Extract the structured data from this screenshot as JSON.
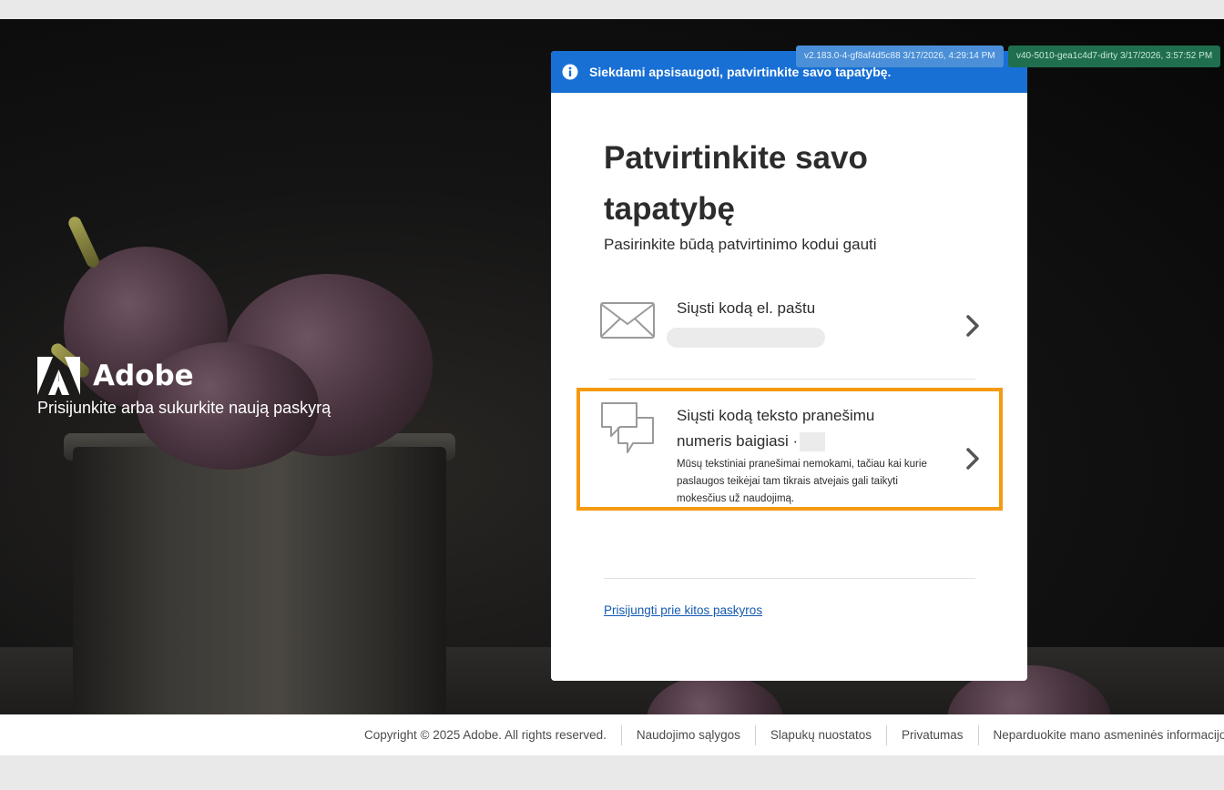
{
  "brand": {
    "name": "Adobe",
    "subtitle": "Prisijunkite arba sukurkite naują paskyrą"
  },
  "version_badges": [
    "v2.183.0-4-gf8af4d5c88 3/17/2026, 4:29:14 PM",
    "v40-5010-gea1c4d7-dirty 3/17/2026, 3:57:52 PM"
  ],
  "banner": {
    "text": "Siekdami apsisaugoti, patvirtinkite savo tapatybę.",
    "icon": "info-icon",
    "color": "#1870d5"
  },
  "card": {
    "title": "Patvirtinkite savo tapatybę",
    "subtitle": "Pasirinkite būdą patvirtinimo kodui gauti",
    "options": [
      {
        "icon": "envelope-icon",
        "title": "Siųsti kodą el. paštu"
      },
      {
        "icon": "chat-bubbles-icon",
        "title": "Siųsti kodą teksto pranešimu numeris baigiasi ·",
        "description": "Mūsų tekstiniai pranešimai nemokami, tačiau kai kurie paslaugos teikėjai tam tikrais atvejais gali taikyti mokesčius už naudojimą.",
        "highlight_color": "#f59a10"
      }
    ],
    "other_account_link": "Prisijungti prie kitos paskyros"
  },
  "footer": {
    "items": [
      "Copyright © 2025 Adobe. All rights reserved.",
      "Naudojimo sąlygos",
      "Slapukų nuostatos",
      "Privatumas",
      "Neparduokite mano asmeninės informacijos ir"
    ]
  }
}
